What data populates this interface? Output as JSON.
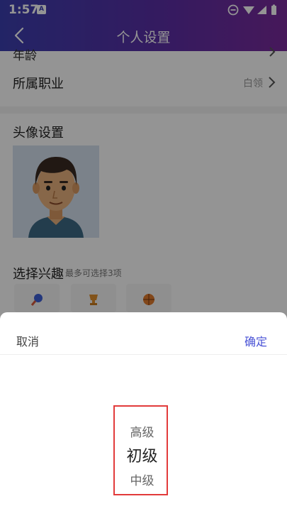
{
  "status_bar": {
    "time": "1:57",
    "app_badge": "A"
  },
  "header": {
    "title": "个人设置"
  },
  "profile": {
    "partial_row_label": "年龄",
    "occupation_label": "所属职业",
    "occupation_value": "白领",
    "avatar_label": "头像设置",
    "interests_label": "选择兴趣",
    "interests_hint": "最多可选择3项"
  },
  "picker": {
    "cancel_label": "取消",
    "confirm_label": "确定",
    "options": [
      "高级",
      "初级",
      "中级"
    ],
    "selected": "初级"
  }
}
